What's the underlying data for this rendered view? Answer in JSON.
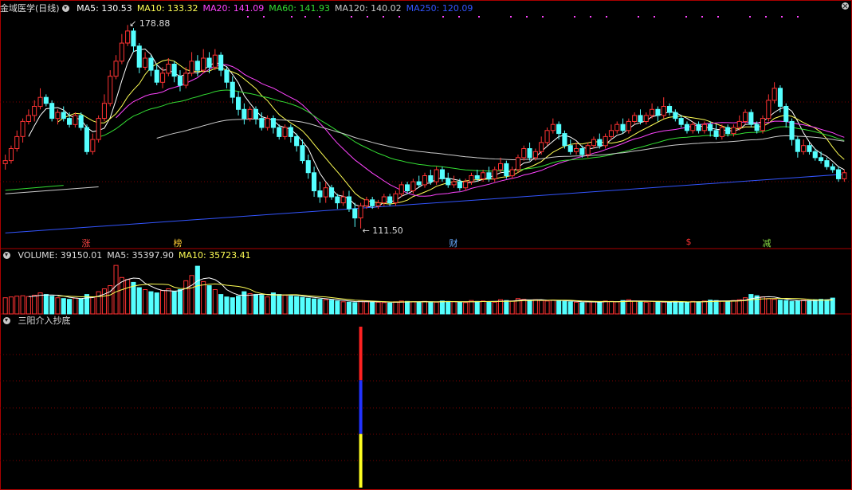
{
  "stock": {
    "name": "金域医学(日线)"
  },
  "price_panel": {
    "indicators": [
      {
        "text": "MA5: 130.53",
        "color": "#ffffff"
      },
      {
        "text": "MA10: 133.32",
        "color": "#ffff55"
      },
      {
        "text": "MA20: 141.09",
        "color": "#ff44ff"
      },
      {
        "text": "MA60: 141.93",
        "color": "#33dd33"
      },
      {
        "text": "MA120: 140.02",
        "color": "#cccccc"
      },
      {
        "text": "MA250: 120.09",
        "color": "#3355ff"
      }
    ],
    "high_label": "178.88",
    "low_label": "111.50",
    "events": [
      {
        "text": "涨",
        "color": "#ff4444"
      },
      {
        "text": "榜",
        "color": "#ffcc33"
      },
      {
        "text": "财",
        "color": "#66aaff"
      },
      {
        "text": "$",
        "color": "#ff3333"
      },
      {
        "text": "减",
        "color": "#88dd44"
      }
    ]
  },
  "volume_panel": {
    "indicators": [
      {
        "text": "VOLUME: 39150.01",
        "color": "#dddddd"
      },
      {
        "text": "MA5: 35397.90",
        "color": "#dddddd"
      },
      {
        "text": "MA10: 35723.41",
        "color": "#ffff55"
      }
    ]
  },
  "signal_panel": {
    "title": "三阳介入抄底"
  },
  "colors": {
    "up": "#ff3333",
    "down": "#55ffff",
    "grid": "#7a0000",
    "border": "#aa0000"
  },
  "chart_data": {
    "type": "candlestick",
    "price_range": [
      108,
      182
    ],
    "high": 178.88,
    "low": 111.5,
    "candles": [
      [
        133,
        134,
        131,
        136,
        1
      ],
      [
        134,
        138,
        133,
        139,
        1
      ],
      [
        138,
        142,
        137,
        144,
        1
      ],
      [
        142,
        147,
        140,
        148,
        1
      ],
      [
        147,
        149,
        146,
        151,
        1
      ],
      [
        149,
        152,
        147,
        154,
        1
      ],
      [
        152,
        155,
        151,
        158,
        1
      ],
      [
        155,
        153,
        152,
        156,
        0
      ],
      [
        153,
        148,
        147,
        154,
        0
      ],
      [
        148,
        150,
        146,
        151,
        1
      ],
      [
        150,
        148,
        147,
        152,
        0
      ],
      [
        148,
        146,
        145,
        150,
        0
      ],
      [
        146,
        149,
        145,
        150,
        1
      ],
      [
        149,
        145,
        144,
        150,
        0
      ],
      [
        145,
        137,
        136,
        146,
        0
      ],
      [
        137,
        141,
        136,
        143,
        1
      ],
      [
        141,
        148,
        140,
        149,
        1
      ],
      [
        148,
        153,
        147,
        156,
        1
      ],
      [
        153,
        162,
        152,
        164,
        1
      ],
      [
        162,
        167,
        161,
        169,
        1
      ],
      [
        167,
        173,
        166,
        176,
        1
      ],
      [
        173,
        177,
        172,
        179,
        1
      ],
      [
        177,
        172,
        170,
        178,
        0
      ],
      [
        172,
        165,
        163,
        173,
        0
      ],
      [
        165,
        168,
        164,
        170,
        1
      ],
      [
        168,
        164,
        162,
        169,
        0
      ],
      [
        164,
        160,
        159,
        166,
        0
      ],
      [
        160,
        163,
        158,
        165,
        1
      ],
      [
        163,
        166,
        162,
        168,
        1
      ],
      [
        166,
        162,
        160,
        167,
        0
      ],
      [
        162,
        159,
        157,
        164,
        0
      ],
      [
        159,
        163,
        158,
        165,
        1
      ],
      [
        163,
        167,
        162,
        170,
        1
      ],
      [
        167,
        164,
        162,
        169,
        0
      ],
      [
        164,
        168,
        163,
        171,
        1
      ],
      [
        168,
        165,
        163,
        170,
        0
      ],
      [
        165,
        169,
        164,
        171,
        1
      ],
      [
        169,
        164,
        162,
        170,
        0
      ],
      [
        164,
        160,
        158,
        165,
        0
      ],
      [
        160,
        155,
        153,
        162,
        0
      ],
      [
        155,
        151,
        149,
        157,
        0
      ],
      [
        151,
        148,
        146,
        153,
        0
      ],
      [
        148,
        151,
        147,
        152,
        1
      ],
      [
        151,
        148,
        146,
        152,
        0
      ],
      [
        148,
        145,
        144,
        150,
        0
      ],
      [
        145,
        148,
        144,
        149,
        1
      ],
      [
        148,
        145,
        143,
        149,
        0
      ],
      [
        145,
        142,
        141,
        146,
        0
      ],
      [
        142,
        145,
        141,
        146,
        1
      ],
      [
        145,
        142,
        140,
        146,
        0
      ],
      [
        142,
        139,
        137,
        143,
        0
      ],
      [
        139,
        134,
        133,
        141,
        0
      ],
      [
        134,
        130,
        128,
        136,
        0
      ],
      [
        130,
        124,
        122,
        132,
        0
      ],
      [
        124,
        122,
        120,
        127,
        0
      ],
      [
        122,
        125,
        120,
        127,
        1
      ],
      [
        125,
        122,
        121,
        126,
        0
      ],
      [
        122,
        120,
        118,
        123,
        0
      ],
      [
        120,
        122,
        119,
        124,
        1
      ],
      [
        122,
        118,
        117,
        124,
        0
      ],
      [
        118,
        115,
        112,
        120,
        0
      ],
      [
        115,
        119,
        111.5,
        120,
        1
      ],
      [
        119,
        121,
        118,
        122,
        1
      ],
      [
        121,
        119,
        118,
        122,
        0
      ],
      [
        119,
        120,
        118,
        121,
        1
      ],
      [
        120,
        122,
        119,
        123,
        1
      ],
      [
        122,
        120,
        119,
        123,
        0
      ],
      [
        120,
        123,
        119,
        124,
        1
      ],
      [
        123,
        126,
        122,
        127,
        1
      ],
      [
        126,
        124,
        123,
        127,
        0
      ],
      [
        124,
        127,
        123,
        128,
        1
      ],
      [
        127,
        126,
        125,
        129,
        0
      ],
      [
        126,
        129,
        125,
        130,
        1
      ],
      [
        129,
        127,
        126,
        131,
        0
      ],
      [
        127,
        131,
        126,
        132,
        1
      ],
      [
        131,
        128,
        127,
        132,
        0
      ],
      [
        128,
        126,
        125,
        130,
        0
      ],
      [
        126,
        127,
        125,
        129,
        1
      ],
      [
        127,
        125,
        124,
        128,
        0
      ],
      [
        125,
        127,
        124,
        128,
        1
      ],
      [
        127,
        129,
        126,
        130,
        1
      ],
      [
        129,
        128,
        127,
        131,
        0
      ],
      [
        128,
        130,
        127,
        131,
        1
      ],
      [
        130,
        128,
        127,
        132,
        0
      ],
      [
        128,
        131,
        127,
        132,
        1
      ],
      [
        131,
        133,
        130,
        135,
        1
      ],
      [
        133,
        129,
        128,
        134,
        0
      ],
      [
        129,
        131,
        128,
        132,
        1
      ],
      [
        131,
        135,
        130,
        136,
        1
      ],
      [
        135,
        138,
        134,
        139,
        1
      ],
      [
        138,
        135,
        134,
        140,
        0
      ],
      [
        135,
        137,
        134,
        138,
        1
      ],
      [
        137,
        140,
        136,
        142,
        1
      ],
      [
        140,
        144,
        139,
        145,
        1
      ],
      [
        144,
        146,
        143,
        148,
        1
      ],
      [
        146,
        143,
        141,
        147,
        0
      ],
      [
        143,
        139,
        138,
        144,
        0
      ],
      [
        139,
        137,
        136,
        141,
        0
      ],
      [
        137,
        138,
        136,
        140,
        1
      ],
      [
        138,
        136,
        135,
        139,
        0
      ],
      [
        136,
        139,
        135,
        140,
        1
      ],
      [
        139,
        141,
        138,
        142,
        1
      ],
      [
        141,
        139,
        138,
        143,
        0
      ],
      [
        139,
        142,
        138,
        143,
        1
      ],
      [
        142,
        144,
        141,
        146,
        1
      ],
      [
        144,
        146,
        143,
        147,
        1
      ],
      [
        146,
        144,
        143,
        148,
        0
      ],
      [
        144,
        147,
        143,
        148,
        1
      ],
      [
        147,
        149,
        146,
        150,
        1
      ],
      [
        149,
        147,
        146,
        151,
        0
      ],
      [
        147,
        149,
        146,
        150,
        1
      ],
      [
        149,
        151,
        148,
        153,
        1
      ],
      [
        151,
        149,
        147,
        152,
        0
      ],
      [
        149,
        152,
        148,
        155,
        1
      ],
      [
        152,
        150,
        149,
        153,
        0
      ],
      [
        150,
        148,
        147,
        151,
        0
      ],
      [
        148,
        146,
        145,
        149,
        0
      ],
      [
        146,
        144,
        143,
        147,
        0
      ],
      [
        144,
        146,
        143,
        147,
        1
      ],
      [
        146,
        144,
        143,
        147,
        0
      ],
      [
        144,
        146,
        143,
        147,
        1
      ],
      [
        146,
        144,
        142,
        147,
        0
      ],
      [
        144,
        142,
        141,
        146,
        0
      ],
      [
        142,
        145,
        141,
        146,
        1
      ],
      [
        145,
        143,
        142,
        146,
        0
      ],
      [
        143,
        145,
        142,
        146,
        1
      ],
      [
        145,
        147,
        144,
        149,
        1
      ],
      [
        147,
        150,
        146,
        151,
        1
      ],
      [
        150,
        146,
        145,
        151,
        0
      ],
      [
        146,
        144,
        143,
        147,
        0
      ],
      [
        144,
        148,
        143,
        149,
        1
      ],
      [
        148,
        154,
        147,
        156,
        1
      ],
      [
        154,
        158,
        153,
        160,
        1
      ],
      [
        158,
        152,
        150,
        159,
        0
      ],
      [
        152,
        147,
        145,
        153,
        0
      ],
      [
        147,
        141,
        139,
        148,
        0
      ],
      [
        141,
        137,
        135,
        142,
        0
      ],
      [
        137,
        139,
        136,
        141,
        1
      ],
      [
        139,
        137,
        136,
        140,
        0
      ],
      [
        137,
        135,
        134,
        138,
        0
      ],
      [
        135,
        134,
        133,
        137,
        0
      ],
      [
        134,
        132,
        131,
        135,
        0
      ],
      [
        132,
        131,
        130,
        133,
        0
      ],
      [
        131,
        128,
        127,
        132,
        0
      ],
      [
        128,
        130,
        127,
        131,
        1
      ]
    ],
    "volume_range": [
      0,
      130000
    ],
    "volume": [
      40000,
      42000,
      44000,
      45000,
      43000,
      46000,
      52000,
      48000,
      44000,
      40000,
      38000,
      36000,
      39000,
      37000,
      48000,
      42000,
      55000,
      62000,
      70000,
      120000,
      90000,
      85000,
      78000,
      65000,
      60000,
      55000,
      52000,
      58000,
      62000,
      55000,
      60000,
      82000,
      95000,
      118000,
      80000,
      70000,
      60000,
      48000,
      42000,
      40000,
      44000,
      55000,
      50000,
      48000,
      46000,
      42000,
      52000,
      48000,
      46000,
      44000,
      43000,
      41000,
      39000,
      37000,
      36000,
      35000,
      34000,
      32000,
      30000,
      29000,
      28000,
      33000,
      31000,
      30000,
      29000,
      28000,
      27000,
      30000,
      32000,
      31000,
      30000,
      29000,
      31000,
      30000,
      29000,
      32000,
      31000,
      30000,
      29000,
      28000,
      33000,
      31000,
      32000,
      30000,
      29000,
      35000,
      33000,
      32000,
      38000,
      36000,
      34000,
      35000,
      33000,
      32000,
      34000,
      33000,
      31000,
      30000,
      29000,
      28000,
      31000,
      30000,
      29000,
      32000,
      31000,
      30000,
      33000,
      35000,
      32000,
      30000,
      29000,
      31000,
      30000,
      29000,
      28000,
      31000,
      30000,
      29000,
      31000,
      30000,
      32000,
      34000,
      33000,
      32000,
      31000,
      33000,
      35000,
      40000,
      48000,
      45000,
      42000,
      38000,
      36000,
      34000,
      33000,
      31000,
      32000,
      34000,
      33000,
      35000,
      36000,
      35000,
      39150
    ],
    "signal": {
      "index": 61,
      "segments": [
        "#ff2222",
        "#2233ff",
        "#ffff22"
      ]
    }
  }
}
